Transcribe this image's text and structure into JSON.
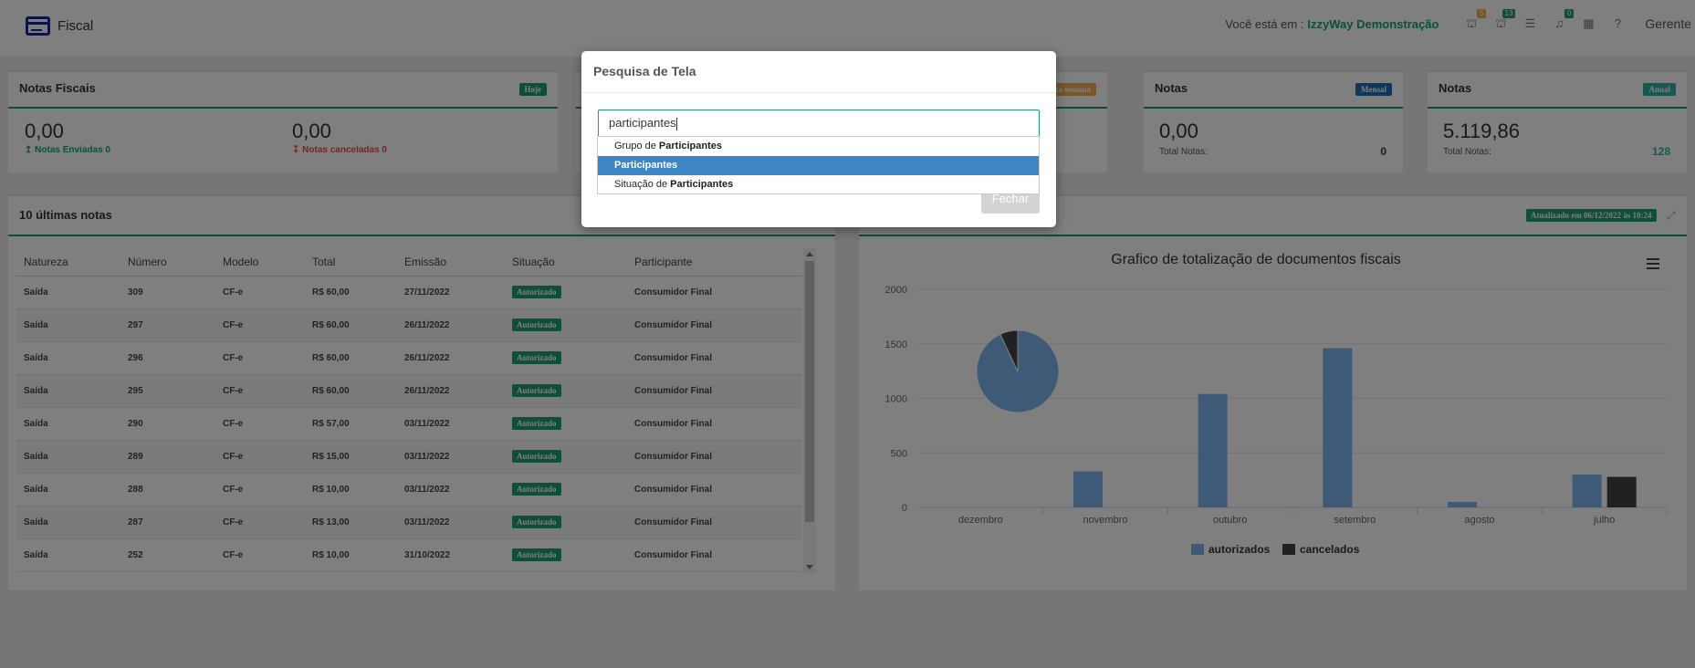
{
  "header": {
    "title": "Fiscal",
    "location_label": "Você está em :",
    "company": "IzzyWay Demonstração",
    "badges": [
      "5",
      "13",
      "0"
    ],
    "user": "Gerente"
  },
  "cards": [
    {
      "title": "Notas Fiscais",
      "tag": "Hoje",
      "val1": "0,00",
      "sub1": "↥ Notas Enviadas 0",
      "val2": "0,00",
      "sub2": "↧ Notas canceladas 0"
    },
    {
      "tag": "esta semana"
    },
    {
      "title": "Notas",
      "tag": "Mensal",
      "val": "0,00",
      "label": "Total Notas:",
      "count": "0"
    },
    {
      "title": "Notas",
      "tag": "Anual",
      "val": "5.119,86",
      "label": "Total Notas:",
      "count": "128"
    }
  ],
  "recent": {
    "title": "10 últimas notas",
    "columns": [
      "Natureza",
      "Número",
      "Modelo",
      "Total",
      "Emissão",
      "Situação",
      "Participante"
    ],
    "rows": [
      [
        "Saída",
        "309",
        "CF-e",
        "R$ 60,00",
        "27/11/2022",
        "Autorizado",
        "Consumidor Final"
      ],
      [
        "Saída",
        "297",
        "CF-e",
        "R$ 60,00",
        "26/11/2022",
        "Autorizado",
        "Consumidor Final"
      ],
      [
        "Saída",
        "296",
        "CF-e",
        "R$ 60,00",
        "26/11/2022",
        "Autorizado",
        "Consumidor Final"
      ],
      [
        "Saída",
        "295",
        "CF-e",
        "R$ 60,00",
        "26/11/2022",
        "Autorizado",
        "Consumidor Final"
      ],
      [
        "Saída",
        "290",
        "CF-e",
        "R$ 57,00",
        "03/11/2022",
        "Autorizado",
        "Consumidor Final"
      ],
      [
        "Saída",
        "289",
        "CF-e",
        "R$ 15,00",
        "03/11/2022",
        "Autorizado",
        "Consumidor Final"
      ],
      [
        "Saída",
        "288",
        "CF-e",
        "R$ 10,00",
        "03/11/2022",
        "Autorizado",
        "Consumidor Final"
      ],
      [
        "Saída",
        "287",
        "CF-e",
        "R$ 13,00",
        "03/11/2022",
        "Autorizado",
        "Consumidor Final"
      ],
      [
        "Saída",
        "252",
        "CF-e",
        "R$ 10,00",
        "31/10/2022",
        "Autorizado",
        "Consumidor Final"
      ]
    ]
  },
  "chart_panel": {
    "updated": "Atualizado em 06/12/2022 às 10:24"
  },
  "chart_data": {
    "type": "bar",
    "title": "Grafico de totalização de documentos fiscais",
    "categories": [
      "dezembro",
      "novembro",
      "outubro",
      "setembro",
      "agosto",
      "julho"
    ],
    "series": [
      {
        "name": "autorizados",
        "values": [
          0,
          330,
          1040,
          1460,
          50,
          300
        ],
        "color": "#7cb5ec"
      },
      {
        "name": "cancelados",
        "values": [
          0,
          0,
          0,
          0,
          0,
          280
        ],
        "color": "#434348"
      }
    ],
    "ylim": [
      0,
      2000
    ],
    "yticks": [
      "0",
      "500",
      "1000",
      "1500",
      "2000"
    ],
    "legend": "bottom-center",
    "grid": true,
    "pie": [
      {
        "name": "autorizados",
        "value": 93
      },
      {
        "name": "cancelados",
        "value": 7
      }
    ]
  },
  "modal": {
    "title": "Pesquisa de Tela",
    "search_value": "participantes",
    "close_label": "Fechar",
    "results": [
      {
        "prefix": "Grupo de ",
        "match": "Participantes",
        "suffix": ""
      },
      {
        "prefix": "",
        "match": "Participantes",
        "suffix": ""
      },
      {
        "prefix": "Situação de ",
        "match": "Participantes",
        "suffix": ""
      }
    ]
  }
}
